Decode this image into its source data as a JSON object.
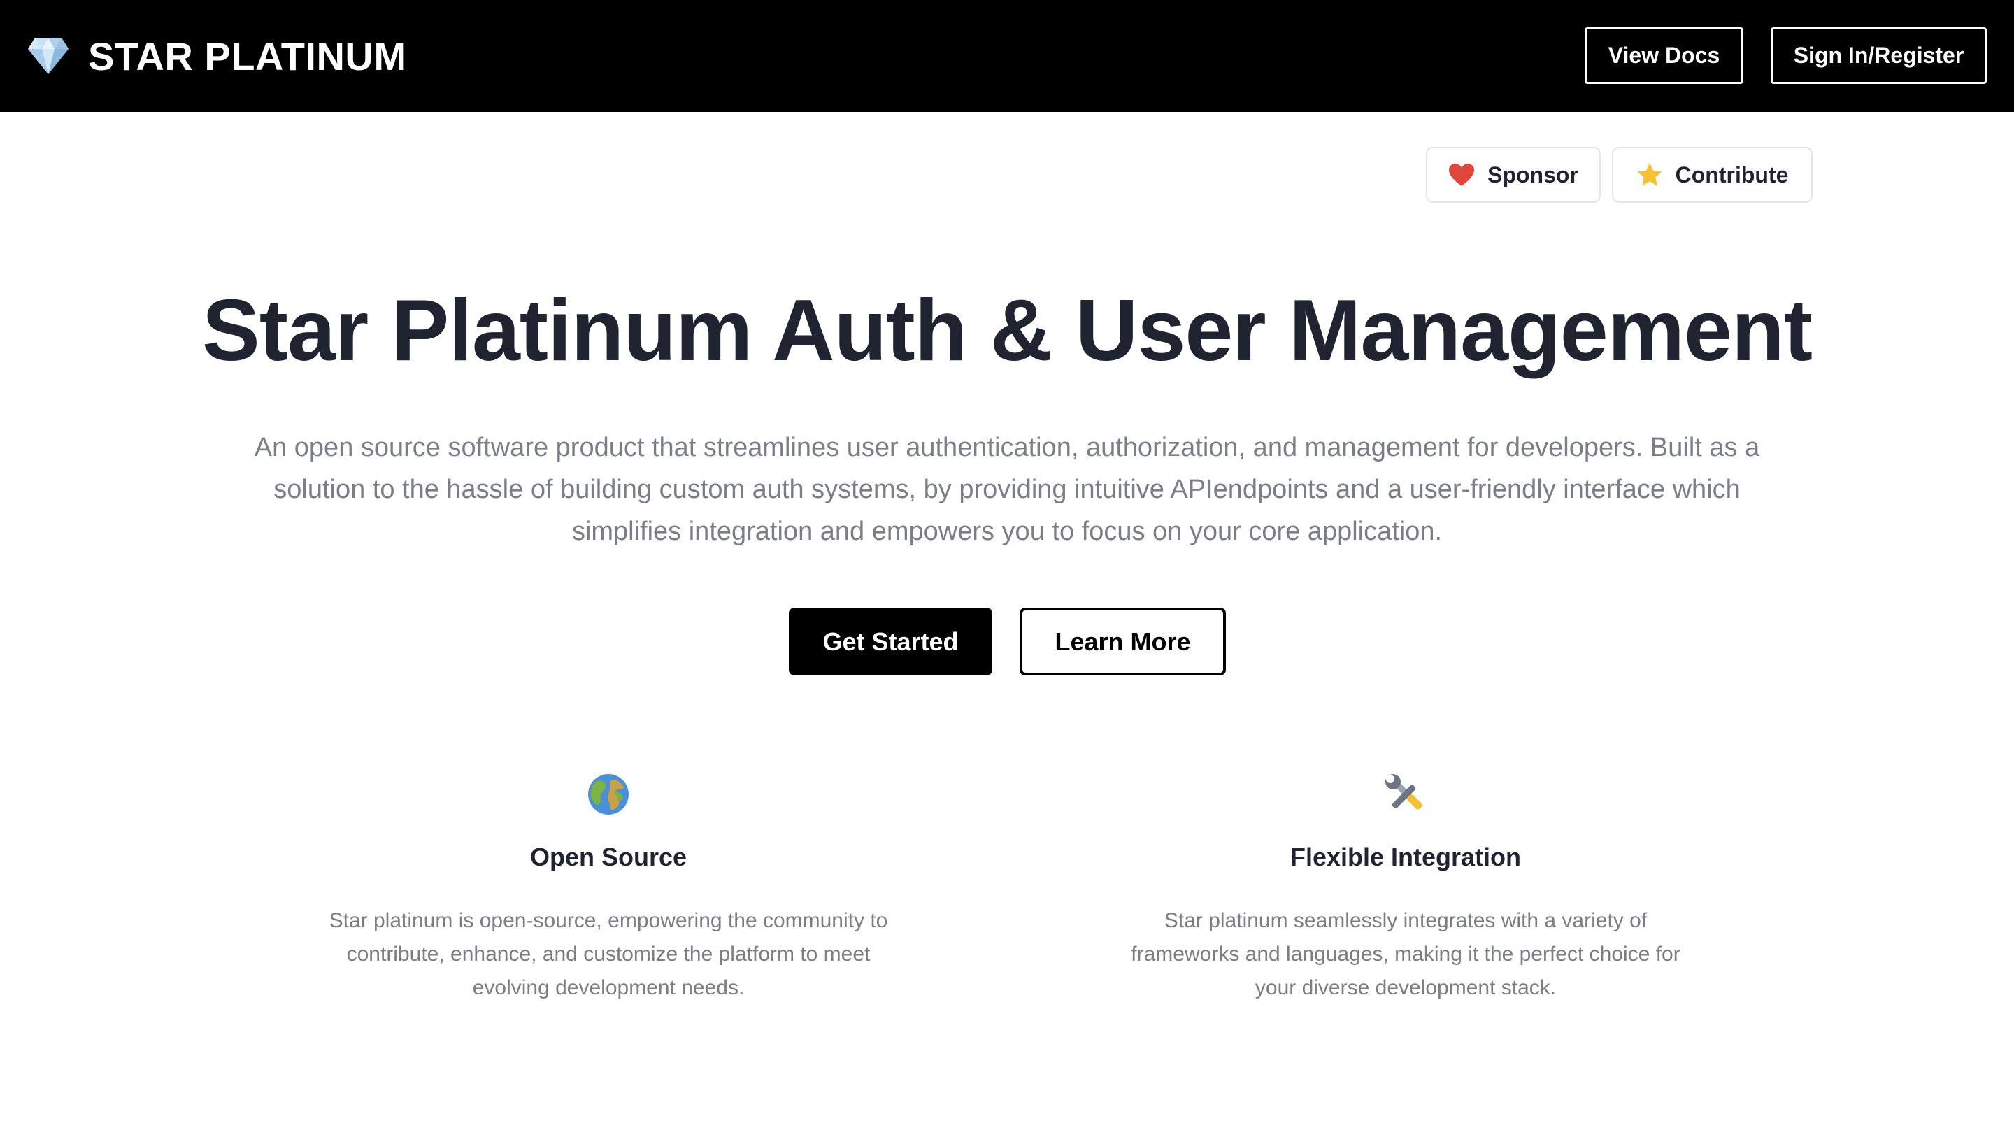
{
  "navbar": {
    "brand_icon": "gem-icon",
    "brand_name": "STAR PLATINUM",
    "view_docs_label": "View Docs",
    "sign_in_label": "Sign In/Register"
  },
  "badges": {
    "sponsor_icon": "heart-icon",
    "sponsor_label": "Sponsor",
    "contribute_icon": "star-icon",
    "contribute_label": "Contribute"
  },
  "hero": {
    "title": "Star Platinum Auth & User Management",
    "description": "An open source software product that streamlines user authentication, authorization, and management for developers. Built as a solution to the hassle of building custom auth systems, by providing intuitive APIendpoints and a user-friendly interface which simplifies integration and empowers you to focus on your core application.",
    "primary_cta": "Get Started",
    "secondary_cta": "Learn More"
  },
  "features": [
    {
      "icon": "globe-icon",
      "title": "Open Source",
      "description": "Star platinum is open-source, empowering the community to contribute, enhance, and customize the platform to meet evolving development needs."
    },
    {
      "icon": "tools-icon",
      "title": "Flexible Integration",
      "description": "Star platinum seamlessly integrates with a variety of frameworks and languages, making it the perfect choice for your diverse development stack."
    }
  ],
  "colors": {
    "navbar_bg": "#000000",
    "heading_text": "#1f2430",
    "muted_text": "#7a7f87",
    "heart_red": "#e0473c",
    "star_yellow": "#f5c131"
  }
}
